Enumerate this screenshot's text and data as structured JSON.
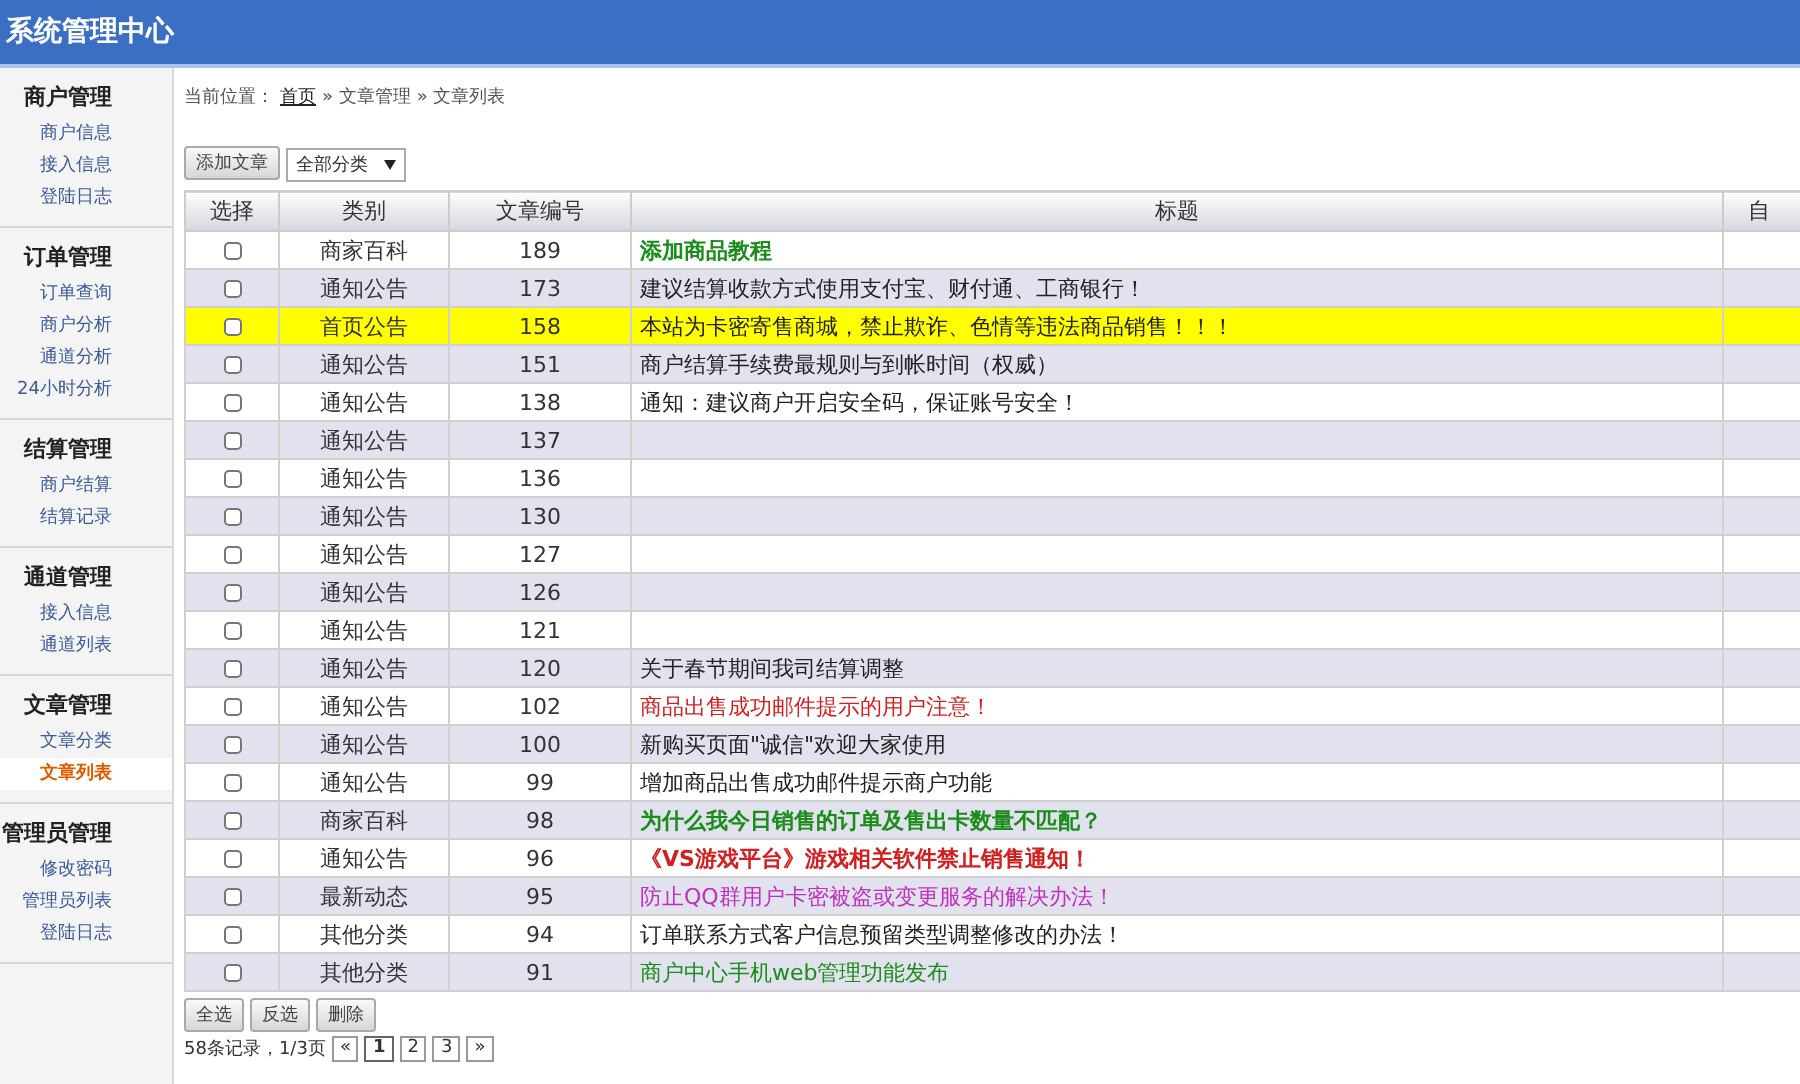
{
  "header": {
    "title": "系统管理中心"
  },
  "sidebar": {
    "groups": [
      {
        "title": "商户管理",
        "items": [
          {
            "label": "商户信息",
            "selected": false
          },
          {
            "label": "接入信息",
            "selected": false
          },
          {
            "label": "登陆日志",
            "selected": false
          }
        ]
      },
      {
        "title": "订单管理",
        "items": [
          {
            "label": "订单查询",
            "selected": false
          },
          {
            "label": "商户分析",
            "selected": false
          },
          {
            "label": "通道分析",
            "selected": false
          },
          {
            "label": "24小时分析",
            "selected": false
          }
        ]
      },
      {
        "title": "结算管理",
        "items": [
          {
            "label": "商户结算",
            "selected": false
          },
          {
            "label": "结算记录",
            "selected": false
          }
        ]
      },
      {
        "title": "通道管理",
        "items": [
          {
            "label": "接入信息",
            "selected": false
          },
          {
            "label": "通道列表",
            "selected": false
          }
        ]
      },
      {
        "title": "文章管理",
        "items": [
          {
            "label": "文章分类",
            "selected": false
          },
          {
            "label": "文章列表",
            "selected": true
          }
        ]
      },
      {
        "title": "管理员管理",
        "items": [
          {
            "label": "修改密码",
            "selected": false
          },
          {
            "label": "管理员列表",
            "selected": false
          },
          {
            "label": "登陆日志",
            "selected": false
          }
        ]
      }
    ]
  },
  "breadcrumb": {
    "prefix": "当前位置：",
    "links": [
      "首页"
    ],
    "trail": [
      "» 文章管理",
      "» 文章列表"
    ]
  },
  "toolbar": {
    "add_button": "添加文章",
    "category_select": "全部分类"
  },
  "table": {
    "columns": [
      "选择",
      "类别",
      "文章编号",
      "标题",
      "自"
    ],
    "rows": [
      {
        "checked": false,
        "category": "商家百科",
        "number": "189",
        "title": "添加商品教程",
        "color": "#1c8c1c",
        "bold": true,
        "highlighted": false
      },
      {
        "checked": false,
        "category": "通知公告",
        "number": "173",
        "title": "建议结算收款方式使用支付宝、财付通、工商银行！",
        "color": "#222222",
        "bold": false,
        "highlighted": false
      },
      {
        "checked": false,
        "category": "首页公告",
        "number": "158",
        "title": "本站为卡密寄售商城，禁止欺诈、色情等违法商品销售！！！",
        "color": "#222222",
        "bold": false,
        "highlighted": true
      },
      {
        "checked": false,
        "category": "通知公告",
        "number": "151",
        "title": "商户结算手续费最规则与到帐时间（权威）",
        "color": "#222222",
        "bold": false,
        "highlighted": false
      },
      {
        "checked": false,
        "category": "通知公告",
        "number": "138",
        "title": "通知：建议商户开启安全码，保证账号安全！",
        "color": "#222222",
        "bold": false,
        "highlighted": false
      },
      {
        "checked": false,
        "category": "通知公告",
        "number": "137",
        "highlighted": false
      },
      {
        "checked": false,
        "category": "通知公告",
        "number": "136",
        "highlighted": false
      },
      {
        "checked": false,
        "category": "通知公告",
        "number": "130",
        "highlighted": false
      },
      {
        "checked": false,
        "category": "通知公告",
        "number": "127",
        "highlighted": false
      },
      {
        "checked": false,
        "category": "通知公告",
        "number": "126",
        "highlighted": false
      },
      {
        "checked": false,
        "category": "通知公告",
        "number": "121",
        "highlighted": false
      },
      {
        "checked": false,
        "category": "通知公告",
        "number": "120",
        "title": "关于春节期间我司结算调整",
        "color": "#222222",
        "bold": false,
        "highlighted": false
      },
      {
        "checked": false,
        "category": "通知公告",
        "number": "102",
        "title": "商品出售成功邮件提示的用户注意！",
        "color": "#d02020",
        "bold": false,
        "highlighted": false
      },
      {
        "checked": false,
        "category": "通知公告",
        "number": "100",
        "title": "新购买页面\"诚信\"欢迎大家使用",
        "color": "#222222",
        "bold": false,
        "highlighted": false
      },
      {
        "checked": false,
        "category": "通知公告",
        "number": "99",
        "title": "增加商品出售成功邮件提示商户功能",
        "color": "#222222",
        "bold": false,
        "highlighted": false
      },
      {
        "checked": false,
        "category": "商家百科",
        "number": "98",
        "title": "为什么我今日销售的订单及售出卡数量不匹配？",
        "color": "#1c8c1c",
        "bold": true,
        "highlighted": false
      },
      {
        "checked": false,
        "category": "通知公告",
        "number": "96",
        "title": "《VS游戏平台》游戏相关软件禁止销售通知！",
        "color": "#d02020",
        "bold": true,
        "highlighted": false
      },
      {
        "checked": false,
        "category": "最新动态",
        "number": "95",
        "title": "防止QQ群用户卡密被盗或变更服务的解决办法！",
        "color": "#c030c0",
        "bold": false,
        "highlighted": false
      },
      {
        "checked": false,
        "category": "其他分类",
        "number": "94",
        "title": "订单联系方式客户信息预留类型调整修改的办法！",
        "color": "#222222",
        "bold": false,
        "highlighted": false
      },
      {
        "checked": false,
        "category": "其他分类",
        "number": "91",
        "title": "商户中心手机web管理功能发布",
        "color": "#1c8c1c",
        "bold": false,
        "highlighted": false
      }
    ]
  },
  "actions": [
    "全选",
    "反选",
    "删除"
  ],
  "pagination": {
    "summary": "58条记录，1/3页",
    "pages": [
      {
        "label": "«",
        "selected": false
      },
      {
        "label": "1",
        "selected": true
      },
      {
        "label": "2",
        "selected": false
      },
      {
        "label": "3",
        "selected": false
      },
      {
        "label": "»",
        "selected": false
      }
    ]
  }
}
